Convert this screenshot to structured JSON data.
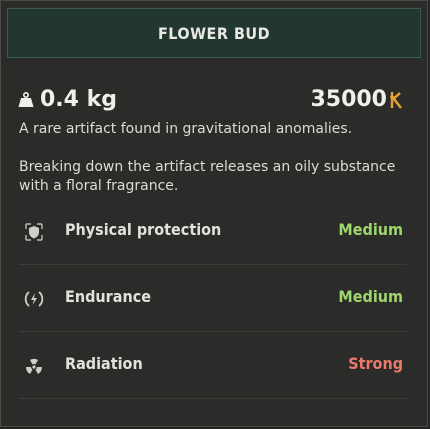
{
  "item": {
    "title": "FLOWER BUD",
    "weight": "0.4 kg",
    "price": "35000",
    "description_1": "A rare artifact found in gravitational anomalies.",
    "description_2": "Breaking down the artifact releases an oily substance with a floral fragrance."
  },
  "properties": [
    {
      "label": "Physical protection",
      "value": "Medium",
      "icon": "shield-icon",
      "value_color": "#9fd66e"
    },
    {
      "label": "Endurance",
      "value": "Medium",
      "icon": "endurance-icon",
      "value_color": "#9fd66e"
    },
    {
      "label": "Radiation",
      "value": "Strong",
      "icon": "radiation-icon",
      "value_color": "#ea7b6c"
    }
  ],
  "colors": {
    "header_bg": "#223730",
    "panel_bg": "#2b2b29",
    "medium": "#9fd66e",
    "strong": "#ea7b6c",
    "coin": "#e8a23a"
  }
}
